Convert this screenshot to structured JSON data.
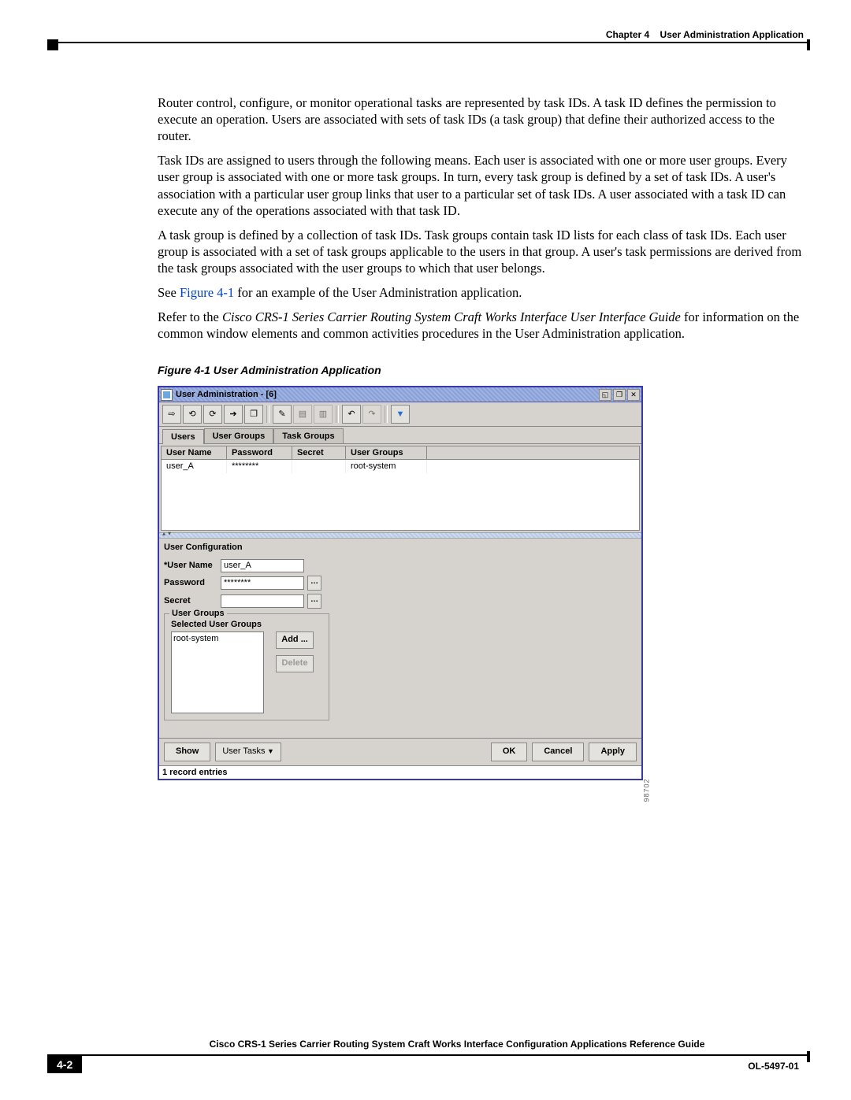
{
  "header": {
    "chapter": "Chapter 4",
    "title": "User Administration Application"
  },
  "paragraphs": {
    "p1": "Router control, configure, or monitor operational tasks are represented by task IDs. A task ID defines the permission to execute an operation. Users are associated with sets of task IDs (a task group) that define their authorized access to the router.",
    "p2": "Task IDs are assigned to users through the following means. Each user is associated with one or more user groups. Every user group is associated with one or more task groups. In turn, every task group is defined by a set of task IDs. A user's association with a particular user group links that user to a particular set of task IDs. A user associated with a task ID can execute any of the operations associated with that task ID.",
    "p3": "A task group is defined by a collection of task IDs. Task groups contain task ID lists for each class of task IDs. Each user group is associated with a set of task groups applicable to the users in that group. A user's task permissions are derived from the task groups associated with the user groups to which that user belongs.",
    "p4_pre": "See ",
    "p4_link": "Figure 4-1",
    "p4_post": " for an example of the User Administration application.",
    "p5_pre": "Refer to the ",
    "p5_it": "Cisco CRS-1 Series Carrier Routing System Craft Works Interface User Interface Guide",
    "p5_post": " for information on the common window elements and common activities procedures in the User Administration application."
  },
  "figure": {
    "caption": "Figure 4-1    User Administration Application",
    "sideno": "98702"
  },
  "win": {
    "title": "User Administration - [6]",
    "tabs": [
      "Users",
      "User Groups",
      "Task Groups"
    ],
    "cols": [
      "User Name",
      "Password",
      "Secret",
      "User Groups"
    ],
    "row": {
      "user": "user_A",
      "pwd": "********",
      "secret": "",
      "groups": "root-system"
    },
    "panel_title": "User Configuration",
    "labels": {
      "uname": "*User Name",
      "pwd": "Password",
      "secret": "Secret"
    },
    "form": {
      "uname": "user_A",
      "pwd": "********",
      "secret": ""
    },
    "fieldset": {
      "legend": "User Groups",
      "sel_label": "Selected User Groups",
      "item": "root-system"
    },
    "buttons": {
      "add": "Add ...",
      "del": "Delete",
      "show": "Show",
      "menu": "User Tasks",
      "ok": "OK",
      "cancel": "Cancel",
      "apply": "Apply"
    },
    "status": "1 record entries"
  },
  "footer": {
    "title": "Cisco CRS-1 Series Carrier Routing System Craft Works Interface Configuration Applications Reference Guide",
    "page": "4-2",
    "docid": "OL-5497-01"
  }
}
